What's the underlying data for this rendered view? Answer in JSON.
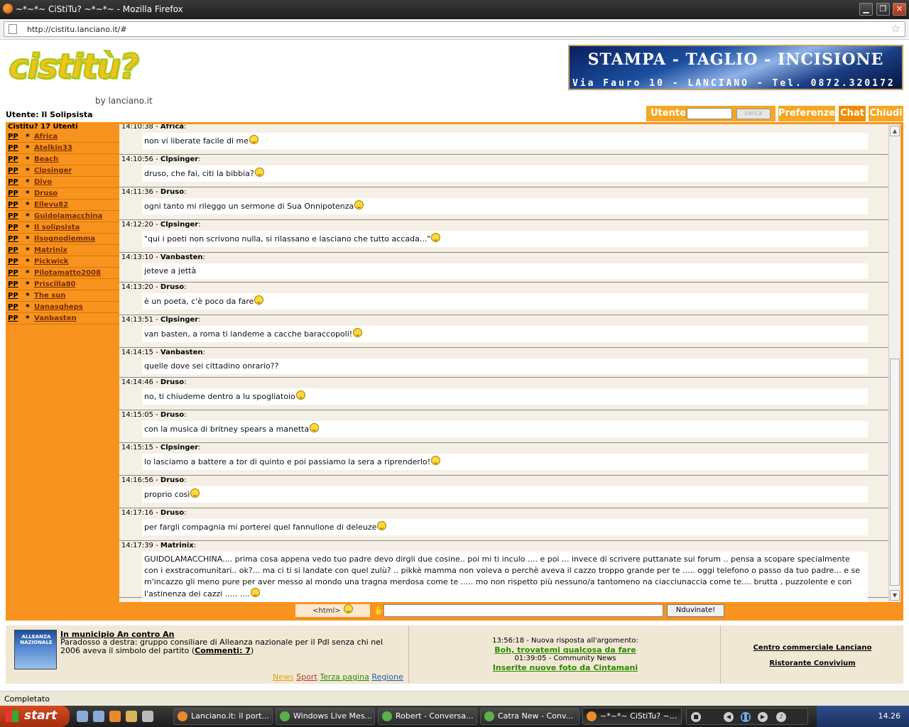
{
  "window": {
    "title": "~*~*~ CiStiTu? ~*~*~ - Mozilla Firefox",
    "minimize": "▁",
    "maximize": "❐",
    "close": "✕"
  },
  "browser": {
    "url": "http://cistitu.lanciano.it/#",
    "status": "Completato"
  },
  "logo": {
    "text": "cistitù?",
    "byline": "by lanciano.it"
  },
  "banner": {
    "line1": "STAMPA - TAGLIO - INCISIONE",
    "line2": "Via Fauro 10 - LANCIANO - Tel. 0872.320172"
  },
  "header": {
    "logged_user": "Utente: Il Solipsista",
    "login_label": "Utente:",
    "login_placeholder": "",
    "search_button": "cerca",
    "nav": [
      "Preferenze",
      "Chat",
      "Chiudi"
    ]
  },
  "sidebar": {
    "heading": "Cistitu? 17 Utenti",
    "pp_label": "PP",
    "star": "*",
    "users": [
      "Africa",
      "Atelkin33",
      "Beach",
      "Clpsinger",
      "Divo",
      "Druso",
      "Ellevu82",
      "Guidolamacchina",
      "Il solipsista",
      "Ilsognodiemma",
      "Matrinix",
      "Pickwick",
      "Pilotamatto2008",
      "Priscilla80",
      "The sun",
      "Uanasgheps",
      "Vanbasten"
    ]
  },
  "chat": {
    "messages": [
      {
        "time": "14:10:38",
        "user": "Africa",
        "text": "non vi liberate facile di me"
      },
      {
        "time": "14:10:56",
        "user": "Clpsinger",
        "text": "druso, che fai, citi la bibbia?"
      },
      {
        "time": "14:11:36",
        "user": "Druso",
        "text": "ogni tanto mi rileggo un sermone di Sua Onnipotenza"
      },
      {
        "time": "14:12:20",
        "user": "Clpsinger",
        "text": "\"qui i poeti non scrivono nulla, si rilassano e lasciano che tutto accada...\""
      },
      {
        "time": "14:13:10",
        "user": "Vanbasten",
        "text": "jeteve a jettà"
      },
      {
        "time": "14:13:20",
        "user": "Druso",
        "text": "è un poeta, c'è poco da fare"
      },
      {
        "time": "14:13:51",
        "user": "Clpsinger",
        "text": "van basten, a roma ti landeme a cacche baraccopoli!"
      },
      {
        "time": "14:14:15",
        "user": "Vanbasten",
        "text": "quelle dove sei cittadino onrario??"
      },
      {
        "time": "14:14:46",
        "user": "Druso",
        "text": "no, ti chiudeme dentro a lu spogliatoio"
      },
      {
        "time": "14:15:05",
        "user": "Druso",
        "text": "con la musica di britney spears a manetta"
      },
      {
        "time": "14:15:15",
        "user": "Clpsinger",
        "text": "lo lasciamo a battere a tor di quinto e poi passiamo la sera a riprenderlo!"
      },
      {
        "time": "14:16:56",
        "user": "Druso",
        "text": "proprio così"
      },
      {
        "time": "14:17:16",
        "user": "Druso",
        "text": "per fargli compagnia mi porterei quel fannullone di deleuze"
      },
      {
        "time": "14:17:39",
        "user": "Matrinix",
        "text": "GUIDOLAMACCHINA.... prima cosa appena vedo tuo padre devo dirgli due cosine.. poi mi ti inculo  .... e poi ... invece di scrivere puttanate sui forum .. pensa a scopare specialmente con i exstracomunitari.. ok?... ma ci ti si landate con quel zulù? .. pikkè mamma non voleva o perchè aveva il cazzo troppo grande per te ..... oggi telefono o passo da tuo padre... e se m'incazzo gli meno pure per aver messo al mondo una tragna merdosa come te  ..... mo non rispetto più nessuno/a tantomeno na ciacciunaccia come te.... brutta , puzzolente e con l'astinenza dei cazzi ..... ...."
      }
    ],
    "html_button": "<html>",
    "send_button": "Nduvinate!"
  },
  "footer": {
    "news": {
      "thumb_text": "ALLEANZA NAZIONALE",
      "title": "In municipio An contro An",
      "text": "Paradosso a destra: gruppo consiliare di Alleanza nazionale per il Pdl senza chi nel 2006 aveva il simbolo del partito (",
      "comments": "Commenti: 7",
      "text_end": ")",
      "categories": [
        "News",
        "Sport",
        "Terza pagina",
        "Regione"
      ]
    },
    "activity": [
      {
        "line": "13:56:18 - Nuova risposta all'argomento:",
        "link": "Boh, trovatemi qualcosa da fare"
      },
      {
        "line": "01:39:05 - Community News",
        "link": "Inserite nuove foto da Cintamani"
      }
    ],
    "links": [
      "Centro commerciale Lanciano",
      "Ristorante Convivium"
    ]
  },
  "taskbar": {
    "start": "start",
    "tasks": [
      "Lanciano.it: il port...",
      "Windows Live Mes...",
      "Robert - Conversa...",
      "Catra New - Conv...",
      "~*~*~ CiStiTu? ~..."
    ],
    "clock": "14.26"
  },
  "colors": {
    "orange": "#f7931e",
    "chat_bg": "#f5f0e6",
    "footer_bg": "#f0e8d4",
    "link_green": "#2e8b00"
  }
}
